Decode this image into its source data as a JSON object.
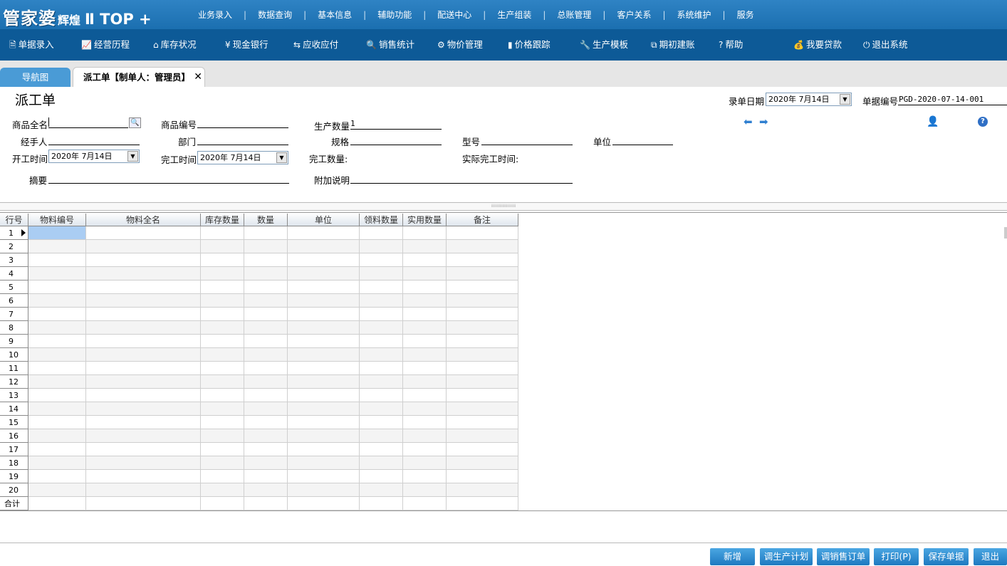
{
  "app": {
    "logo_main": "管家婆",
    "logo_sub": "辉煌",
    "logo_edition": "Ⅱ TOP +"
  },
  "top_menu": [
    "业务录入",
    "数据查询",
    "基本信息",
    "辅助功能",
    "配送中心",
    "生产组装",
    "总账管理",
    "客户关系",
    "系统维护",
    "服务"
  ],
  "toolbar": [
    {
      "label": "单据录入",
      "icon": "document-icon"
    },
    {
      "label": "经营历程",
      "icon": "chart-line-icon"
    },
    {
      "label": "库存状况",
      "icon": "home-icon"
    },
    {
      "label": "现金银行",
      "icon": "yen-icon"
    },
    {
      "label": "应收应付",
      "icon": "exchange-icon"
    },
    {
      "label": "销售统计",
      "icon": "search-icon"
    },
    {
      "label": "物价管理",
      "icon": "gear-icon"
    },
    {
      "label": "价格跟踪",
      "icon": "bar-chart-icon"
    },
    {
      "label": "生产模板",
      "icon": "wrench-icon"
    },
    {
      "label": "期初建账",
      "icon": "external-link-icon"
    },
    {
      "label": "帮助",
      "icon": "question-icon"
    },
    {
      "label": "我要贷款",
      "icon": "money-bag-icon"
    },
    {
      "label": "退出系统",
      "icon": "power-icon"
    }
  ],
  "tabs": {
    "nav": "导航图",
    "active": "派工单【制单人：管理员】",
    "close": "✕"
  },
  "form": {
    "title": "派工单",
    "entry_date_label": "录单日期",
    "entry_date": "2020年 7月14日",
    "doc_no_label": "单据编号",
    "doc_no": "PGD-2020-07-14-001",
    "product_name_label": "商品全名",
    "product_code_label": "商品编号",
    "production_qty_label": "生产数量",
    "production_qty": "1",
    "handler_label": "经手人",
    "department_label": "部门",
    "spec_label": "规格",
    "model_label": "型号",
    "unit_label": "单位",
    "start_time_label": "开工时间",
    "start_time": "2020年 7月14日",
    "end_time_label": "完工时间",
    "end_time": "2020年 7月14日",
    "completed_qty_label": "完工数量:",
    "actual_end_label": "实际完工时间:",
    "summary_label": "摘要",
    "note_label": "附加说明"
  },
  "grid": {
    "columns": [
      "行号",
      "物料编号",
      "物料全名",
      "库存数量",
      "数量",
      "单位",
      "领料数量",
      "实用数量",
      "备注"
    ],
    "rows": [
      "1",
      "2",
      "3",
      "4",
      "5",
      "6",
      "7",
      "8",
      "9",
      "10",
      "11",
      "12",
      "13",
      "14",
      "15",
      "16",
      "17",
      "18",
      "19",
      "20"
    ],
    "total_label": "合计"
  },
  "buttons": [
    "新增",
    "调生产计划",
    "调销售订单",
    "打印(P)",
    "保存单据",
    "退出"
  ]
}
